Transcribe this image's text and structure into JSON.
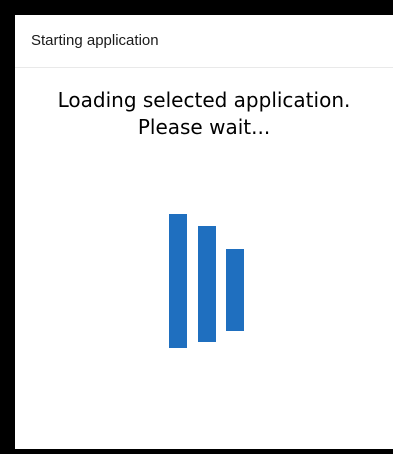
{
  "dialog": {
    "title": "Starting application",
    "message_line1": "Loading selected application.",
    "message_line2": "Please wait..."
  },
  "loader": {
    "icon": "loading-bars-icon",
    "color": "#1f6fbf"
  },
  "colors": {
    "background": "#000000",
    "dialog": "#ffffff",
    "accent": "#1f6fbf"
  }
}
